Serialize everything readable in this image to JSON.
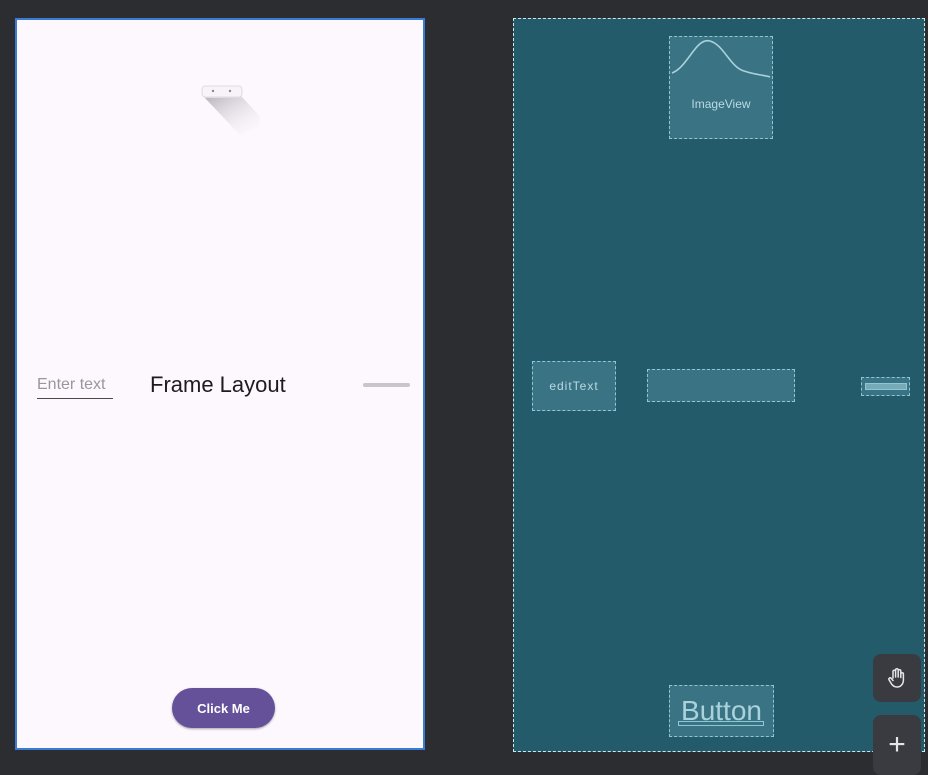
{
  "design": {
    "edit_hint": "Enter text",
    "title": "Frame Layout",
    "button_label": "Click Me",
    "colors": {
      "surface": "#fdf7fe",
      "button": "#65519a",
      "selection": "#3a7bd5"
    }
  },
  "blueprint": {
    "image_label": "ImageView",
    "edit_label": "editText",
    "button_label": "Button",
    "colors": {
      "surface": "#235b6b",
      "outline": "#8fc6d4"
    }
  },
  "tools": [
    {
      "name": "pan-tool",
      "icon": "hand-icon"
    },
    {
      "name": "add-tool",
      "icon": "plus-icon",
      "glyph": "+"
    }
  ]
}
